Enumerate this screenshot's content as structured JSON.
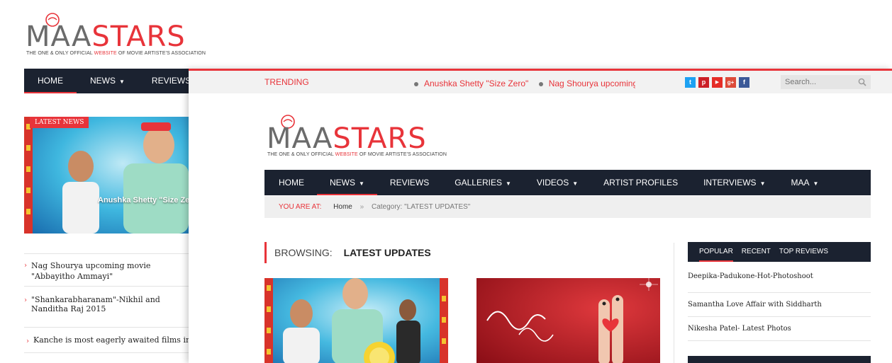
{
  "background_page": {
    "logo": {
      "maa": "MAA",
      "stars": "STARS",
      "tag_prefix": "THE ONE & ONLY OFFICIAL ",
      "tag_red": "WEBSITE",
      "tag_suffix": " OF MOVIE ARTISTE'S ASSOCIATION"
    },
    "nav": [
      {
        "label": "HOME",
        "active": true
      },
      {
        "label": "NEWS",
        "dropdown": true
      },
      {
        "label": "REVIEWS"
      }
    ],
    "hero": {
      "badge": "LATEST NEWS",
      "caption": "Anushka Shetty \"Size Zero\""
    },
    "news_list": [
      "Nag Shourya upcoming movie \"Abbayitho Ammayi\"",
      "\"Shankarabharanam\"-Nikhil and Nanditha Raj 2015",
      "Kanche is most eagerly awaited films in Tollywood"
    ]
  },
  "topbar": {
    "trending_label": "TRENDING",
    "trending_items": [
      "Anushka Shetty \"Size Zero\"",
      "Nag Shourya upcoming m"
    ],
    "social_icons": [
      {
        "name": "twitter-icon",
        "glyph": "t",
        "color": "#1da1f2"
      },
      {
        "name": "pinterest-icon",
        "glyph": "p",
        "color": "#cb2027"
      },
      {
        "name": "youtube-icon",
        "glyph": "▶",
        "color": "#e52d27"
      },
      {
        "name": "googleplus-icon",
        "glyph": "g+",
        "color": "#dd4b39"
      },
      {
        "name": "facebook-icon",
        "glyph": "f",
        "color": "#3b5998"
      }
    ],
    "search_placeholder": "Search..."
  },
  "logo": {
    "maa": "MAA",
    "stars": "STARS",
    "tag_prefix": "THE ONE & ONLY OFFICIAL ",
    "tag_red": "WEBSITE",
    "tag_suffix": " OF MOVIE ARTISTE'S ASSOCIATION"
  },
  "main_nav": [
    {
      "label": "HOME"
    },
    {
      "label": "NEWS",
      "dropdown": true,
      "active": true
    },
    {
      "label": "REVIEWS"
    },
    {
      "label": "GALLERIES",
      "dropdown": true
    },
    {
      "label": "VIDEOS",
      "dropdown": true
    },
    {
      "label": "ARTIST PROFILES"
    },
    {
      "label": "INTERVIEWS",
      "dropdown": true
    },
    {
      "label": "MAA",
      "dropdown": true
    }
  ],
  "breadcrumb": {
    "label": "YOU ARE AT:",
    "home": "Home",
    "separator": "»",
    "current": "Category: \"LATEST UPDATES\""
  },
  "browsing": {
    "prefix": "BROWSING:",
    "category": "LATEST UPDATES"
  },
  "sidebar": {
    "tabs": [
      {
        "label": "POPULAR",
        "active": true
      },
      {
        "label": "RECENT"
      },
      {
        "label": "TOP REVIEWS"
      }
    ],
    "popular": [
      "Deepika-Padukone-Hot-Photoshoot",
      "Samantha Love Affair with Siddharth",
      "Nikesha Patel- Latest Photos"
    ]
  },
  "colors": {
    "accent": "#e8343a",
    "nav_bg": "#1b2230",
    "logo_grey": "#6b6b6b"
  }
}
